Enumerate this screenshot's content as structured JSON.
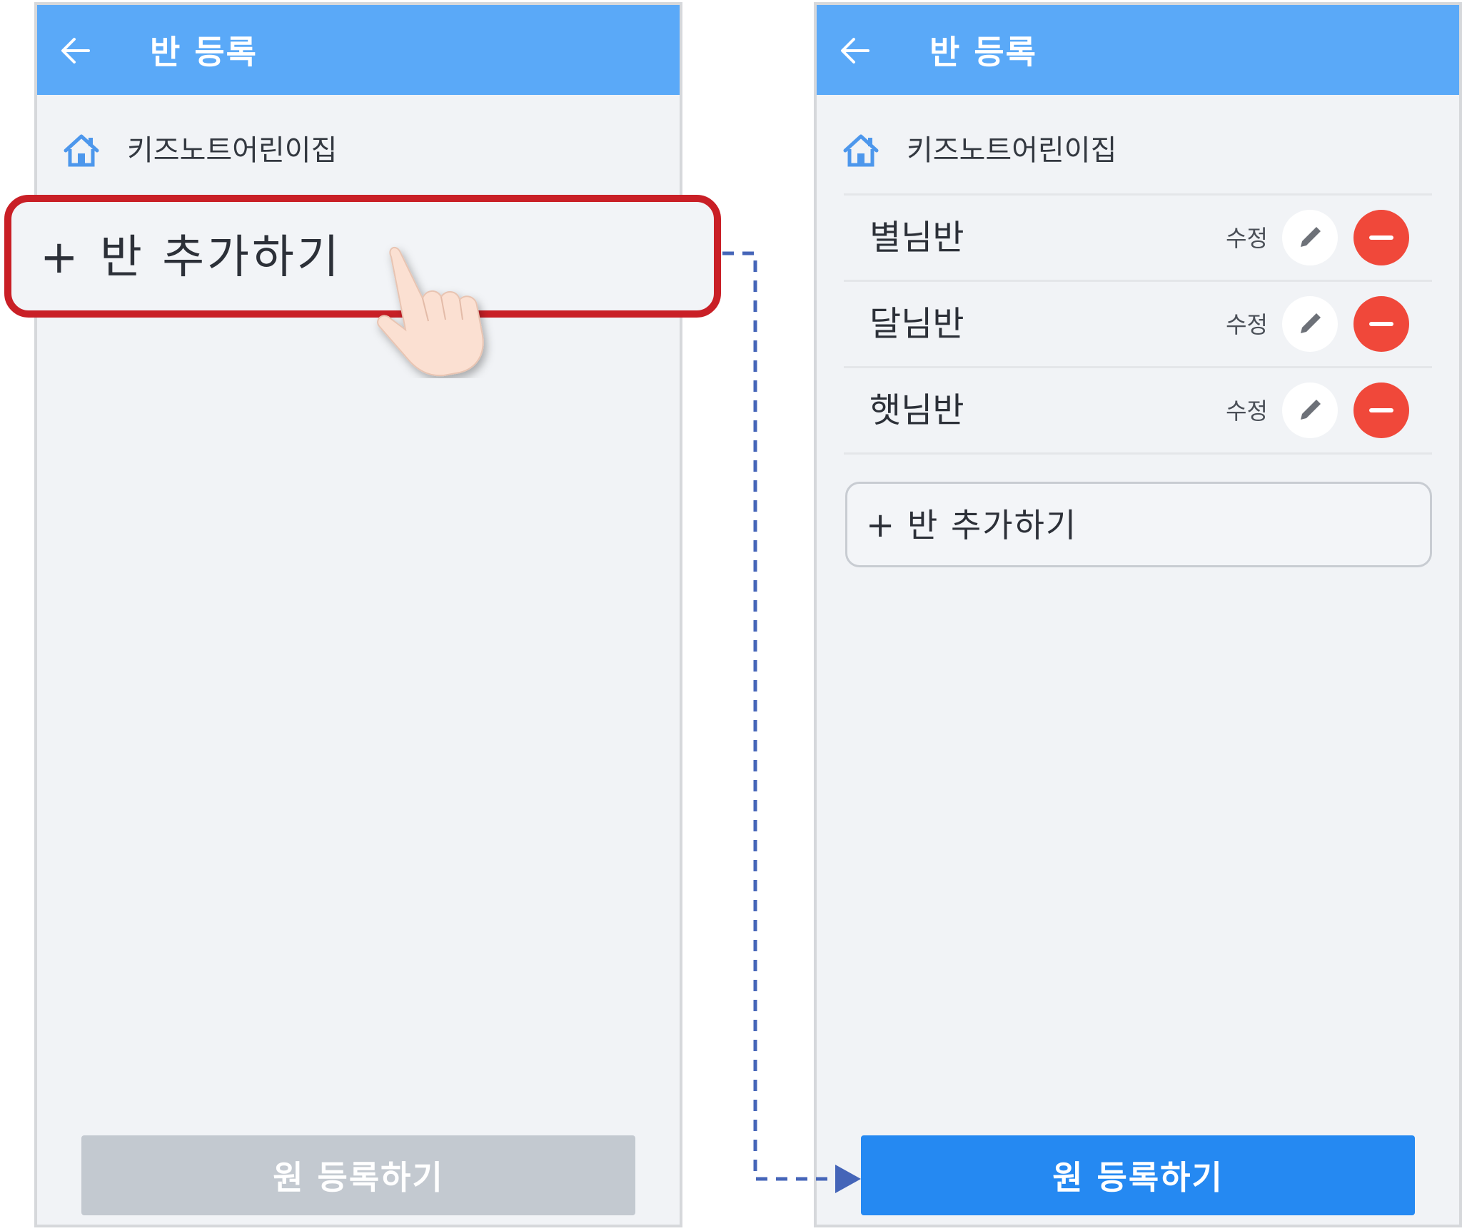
{
  "left_screen": {
    "header": {
      "title": "반 등록"
    },
    "kindergarten": {
      "name": "키즈노트어린이집"
    },
    "add_class": {
      "plus": "+",
      "label": "반 추가하기"
    },
    "footer": {
      "register_label": "원 등록하기"
    }
  },
  "right_screen": {
    "header": {
      "title": "반 등록"
    },
    "kindergarten": {
      "name": "키즈노트어린이집"
    },
    "classes": [
      {
        "name": "별님반",
        "edit_label": "수정"
      },
      {
        "name": "달님반",
        "edit_label": "수정"
      },
      {
        "name": "햇님반",
        "edit_label": "수정"
      }
    ],
    "add_class": {
      "plus": "+",
      "label": "반 추가하기"
    },
    "footer": {
      "register_label": "원 등록하기"
    }
  },
  "colors": {
    "header": "#5aa9f8",
    "highlight": "#c91f26",
    "remove": "#f0483a",
    "primary": "#2589f2",
    "disabled": "#c3c9d0",
    "connector": "#4565b8"
  }
}
